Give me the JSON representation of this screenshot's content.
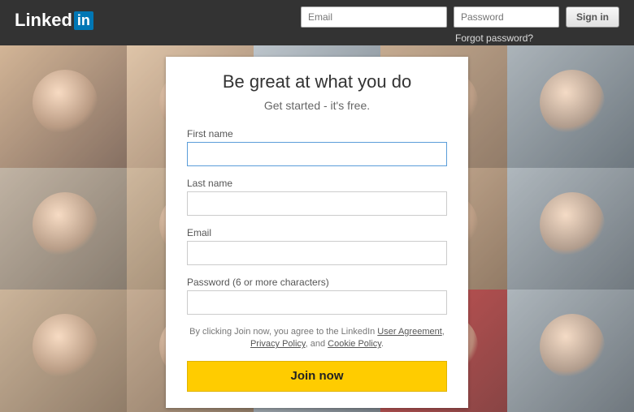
{
  "brand": {
    "text": "Linked",
    "badge": "in"
  },
  "topbar": {
    "email_placeholder": "Email",
    "password_placeholder": "Password",
    "signin_label": "Sign in",
    "forgot_label": "Forgot password?"
  },
  "signup": {
    "title": "Be great at what you do",
    "subtitle": "Get started - it's free.",
    "first_name_label": "First name",
    "last_name_label": "Last name",
    "email_label": "Email",
    "password_label": "Password (6 or more characters)",
    "terms_prefix": "By clicking Join now, you agree to the LinkedIn ",
    "terms_user_agreement": "User Agreement",
    "terms_sep1": ", ",
    "terms_privacy": "Privacy Policy",
    "terms_sep2": ", and ",
    "terms_cookie": "Cookie Policy",
    "terms_suffix": ".",
    "join_label": "Join now"
  }
}
